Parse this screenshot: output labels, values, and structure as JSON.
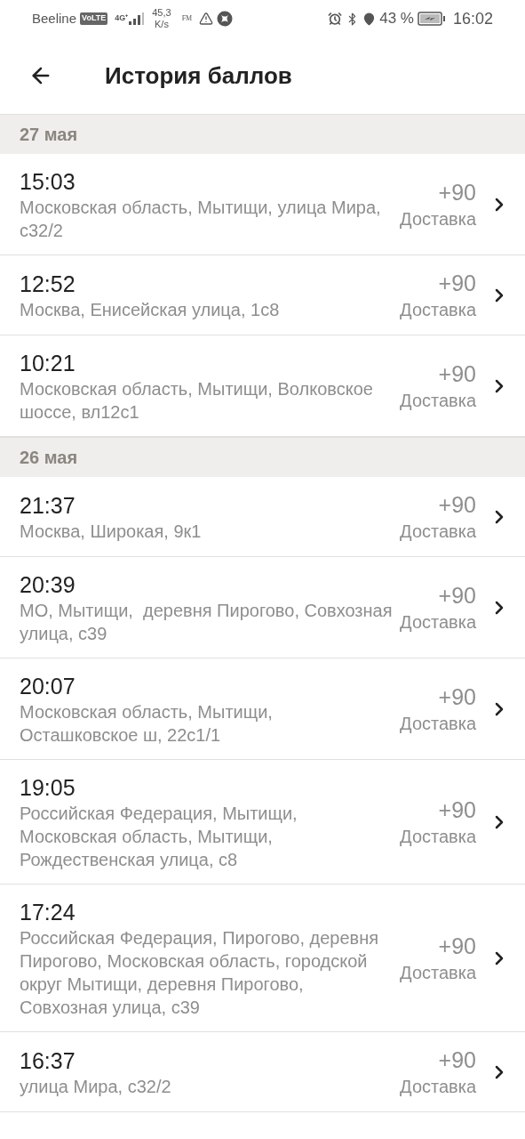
{
  "status_bar": {
    "carrier": "Beeline",
    "volte": "VoLTE",
    "network": "4G⁺",
    "speed": [
      "45,3",
      "K/s"
    ],
    "fm": "FM",
    "battery": "43 %",
    "time": "16:02"
  },
  "header": {
    "title": "История баллов"
  },
  "sections": [
    {
      "date": "27 мая",
      "items": [
        {
          "time": "15:03",
          "address": "Московская область, Мытищи, улица Мира, с32/2",
          "points": "+90",
          "type": "Доставка"
        },
        {
          "time": "12:52",
          "address": "Москва, Енисейская улица, 1с8",
          "points": "+90",
          "type": "Доставка"
        },
        {
          "time": "10:21",
          "address": "Московская область, Мытищи, Волковское шоссе, вл12с1",
          "points": "+90",
          "type": "Доставка"
        }
      ]
    },
    {
      "date": "26 мая",
      "items": [
        {
          "time": "21:37",
          "address": "Москва, Широкая, 9к1",
          "points": "+90",
          "type": "Доставка"
        },
        {
          "time": "20:39",
          "address": "МО, Мытищи,  деревня Пирогово, Совхозная улица, с39",
          "points": "+90",
          "type": "Доставка"
        },
        {
          "time": "20:07",
          "address": "Московская область, Мытищи, Осташковское ш, 22с1/1",
          "points": "+90",
          "type": "Доставка"
        },
        {
          "time": "19:05",
          "address": "Российская Федерация, Мытищи, Московская область, Мытищи, Рождественская улица, с8",
          "points": "+90",
          "type": "Доставка"
        },
        {
          "time": "17:24",
          "address": "Российская Федерация, Пирогово, деревня Пирогово, Московская область, городской округ Мытищи, деревня Пирогово, Совхозная улица, с39",
          "points": "+90",
          "type": "Доставка"
        },
        {
          "time": "16:37",
          "address": "улица Мира, с32/2",
          "points": "+90",
          "type": "Доставка"
        }
      ]
    }
  ]
}
